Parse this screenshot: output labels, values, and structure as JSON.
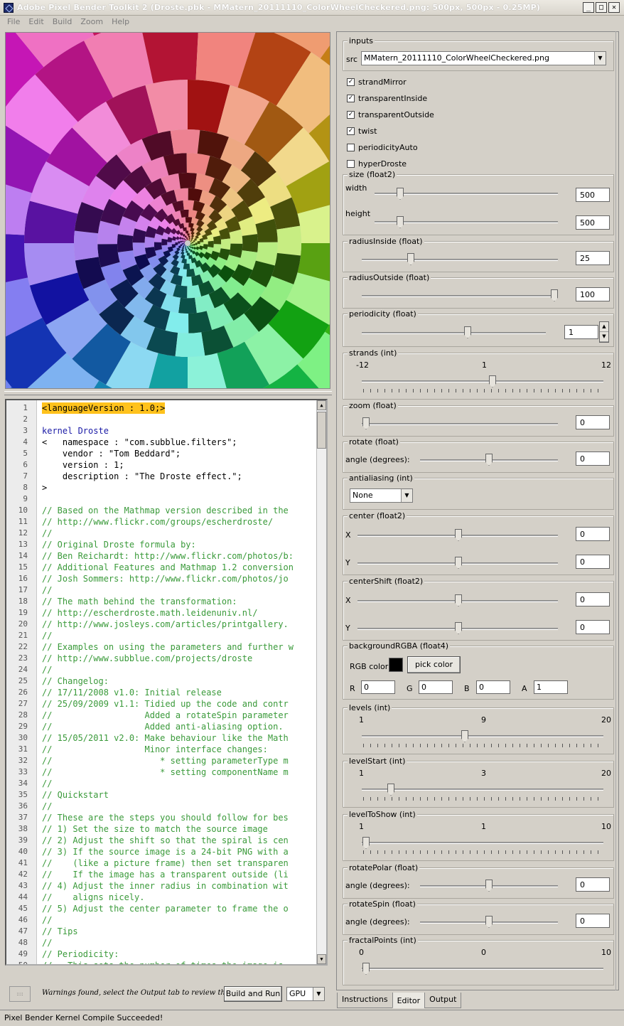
{
  "window": {
    "title": "Adobe Pixel Bender Toolkit 2 (Droste.pbk - MMatern_20111110_ColorWheelCheckered.png: 500px, 500px - 0.25MP)",
    "min": "_",
    "max": "□",
    "close": "✕"
  },
  "menu": [
    "File",
    "Edit",
    "Build",
    "Zoom",
    "Help"
  ],
  "code_lines": [
    {
      "n": "1",
      "t": "<languageVersion : 1.0;>",
      "c": "hl"
    },
    {
      "n": "2",
      "t": "",
      "c": ""
    },
    {
      "n": "3",
      "t": "kernel Droste",
      "c": "kw"
    },
    {
      "n": "4",
      "t": "<   namespace : \"com.subblue.filters\";",
      "c": ""
    },
    {
      "n": "5",
      "t": "    vendor : \"Tom Beddard\";",
      "c": ""
    },
    {
      "n": "6",
      "t": "    version : 1;",
      "c": ""
    },
    {
      "n": "7",
      "t": "    description : \"The Droste effect.\";",
      "c": ""
    },
    {
      "n": "8",
      "t": ">",
      "c": ""
    },
    {
      "n": "9",
      "t": "",
      "c": ""
    },
    {
      "n": "10",
      "t": "// Based on the Mathmap version described in the",
      "c": "comment"
    },
    {
      "n": "11",
      "t": "// http://www.flickr.com/groups/escherdroste/",
      "c": "comment"
    },
    {
      "n": "12",
      "t": "//",
      "c": "comment"
    },
    {
      "n": "13",
      "t": "// Original Droste formula by:",
      "c": "comment"
    },
    {
      "n": "14",
      "t": "// Ben Reichardt: http://www.flickr.com/photos/b:",
      "c": "comment"
    },
    {
      "n": "15",
      "t": "// Additional Features and Mathmap 1.2 conversion",
      "c": "comment"
    },
    {
      "n": "16",
      "t": "// Josh Sommers: http://www.flickr.com/photos/jo",
      "c": "comment"
    },
    {
      "n": "17",
      "t": "//",
      "c": "comment"
    },
    {
      "n": "18",
      "t": "// The math behind the transformation:",
      "c": "comment"
    },
    {
      "n": "19",
      "t": "// http://escherdroste.math.leidenuniv.nl/",
      "c": "comment"
    },
    {
      "n": "20",
      "t": "// http://www.josleys.com/articles/printgallery.",
      "c": "comment"
    },
    {
      "n": "21",
      "t": "//",
      "c": "comment"
    },
    {
      "n": "22",
      "t": "// Examples on using the parameters and further w",
      "c": "comment"
    },
    {
      "n": "23",
      "t": "// http://www.subblue.com/projects/droste",
      "c": "comment"
    },
    {
      "n": "24",
      "t": "//",
      "c": "comment"
    },
    {
      "n": "25",
      "t": "// Changelog:",
      "c": "comment"
    },
    {
      "n": "26",
      "t": "// 17/11/2008 v1.0: Initial release",
      "c": "comment"
    },
    {
      "n": "27",
      "t": "// 25/09/2009 v1.1: Tidied up the code and contr",
      "c": "comment"
    },
    {
      "n": "28",
      "t": "//                  Added a rotateSpin parameter",
      "c": "comment"
    },
    {
      "n": "29",
      "t": "//                  Added anti-aliasing option.",
      "c": "comment"
    },
    {
      "n": "30",
      "t": "// 15/05/2011 v2.0: Make behaviour like the Math",
      "c": "comment"
    },
    {
      "n": "31",
      "t": "//                  Minor interface changes:",
      "c": "comment"
    },
    {
      "n": "32",
      "t": "//                     * setting parameterType m",
      "c": "comment"
    },
    {
      "n": "33",
      "t": "//                     * setting componentName m",
      "c": "comment"
    },
    {
      "n": "34",
      "t": "//",
      "c": "comment"
    },
    {
      "n": "35",
      "t": "// Quickstart",
      "c": "comment"
    },
    {
      "n": "36",
      "t": "//",
      "c": "comment"
    },
    {
      "n": "37",
      "t": "// These are the steps you should follow for bes",
      "c": "comment"
    },
    {
      "n": "38",
      "t": "// 1) Set the size to match the source image",
      "c": "comment"
    },
    {
      "n": "39",
      "t": "// 2) Adjust the shift so that the spiral is cen",
      "c": "comment"
    },
    {
      "n": "40",
      "t": "// 3) If the source image is a 24-bit PNG with a",
      "c": "comment"
    },
    {
      "n": "41",
      "t": "//    (like a picture frame) then set transparen",
      "c": "comment"
    },
    {
      "n": "42",
      "t": "//    If the image has a transparent outside (li",
      "c": "comment"
    },
    {
      "n": "43",
      "t": "// 4) Adjust the inner radius in combination wit",
      "c": "comment"
    },
    {
      "n": "44",
      "t": "//    aligns nicely.",
      "c": "comment"
    },
    {
      "n": "45",
      "t": "// 5) Adjust the center parameter to frame the o",
      "c": "comment"
    },
    {
      "n": "46",
      "t": "//",
      "c": "comment"
    },
    {
      "n": "47",
      "t": "// Tips",
      "c": "comment"
    },
    {
      "n": "48",
      "t": "//",
      "c": "comment"
    },
    {
      "n": "49",
      "t": "// Periodicity:",
      "c": "comment"
    },
    {
      "n": "50",
      "t": "//   This sets the number of times the image is",
      "c": "comment"
    }
  ],
  "bottom": {
    "grip": "::::",
    "warning": "Warnings found, select the Output tab to review them.",
    "build_button": "Build and Run",
    "device": "GPU"
  },
  "status": "Pixel Bender Kernel Compile Succeeded!",
  "params": {
    "inputs": {
      "label": "inputs",
      "src_label": "src",
      "src_value": "MMatern_20111110_ColorWheelCheckered.png"
    },
    "checkboxes": [
      {
        "label": "strandMirror",
        "checked": true
      },
      {
        "label": "transparentInside",
        "checked": true
      },
      {
        "label": "transparentOutside",
        "checked": true
      },
      {
        "label": "twist",
        "checked": true
      },
      {
        "label": "periodicityAuto",
        "checked": false
      },
      {
        "label": "hyperDroste",
        "checked": false
      }
    ],
    "size": {
      "label": "size (float2)",
      "width_label": "width",
      "width": "500",
      "height_label": "height",
      "height": "500"
    },
    "radiusInside": {
      "label": "radiusInside (float)",
      "value": "25"
    },
    "radiusOutside": {
      "label": "radiusOutside (float)",
      "value": "100"
    },
    "periodicity": {
      "label": "periodicity (float)",
      "value": "1"
    },
    "strands": {
      "label": "strands (int)",
      "min": "-12",
      "cur": "1",
      "max": "12"
    },
    "zoom": {
      "label": "zoom (float)",
      "value": "0"
    },
    "rotate": {
      "label": "rotate (float)",
      "angle_label": "angle (degrees):",
      "value": "0"
    },
    "antialiasing": {
      "label": "antialiasing (int)",
      "value": "None"
    },
    "center": {
      "label": "center (float2)",
      "x_label": "X",
      "x": "0",
      "y_label": "Y",
      "y": "0"
    },
    "centerShift": {
      "label": "centerShift (float2)",
      "x_label": "X",
      "x": "0",
      "y_label": "Y",
      "y": "0"
    },
    "backgroundRGBA": {
      "label": "backgroundRGBA (float4)",
      "rgb_label": "RGB color:",
      "pick": "pick color",
      "swatch": "#000000",
      "r_label": "R",
      "r": "0",
      "g_label": "G",
      "g": "0",
      "b_label": "B",
      "b": "0",
      "a_label": "A",
      "a": "1"
    },
    "levels": {
      "label": "levels (int)",
      "min": "1",
      "cur": "9",
      "max": "20"
    },
    "levelStart": {
      "label": "levelStart (int)",
      "min": "1",
      "cur": "3",
      "max": "20"
    },
    "levelToShow": {
      "label": "levelToShow (int)",
      "min": "1",
      "cur": "1",
      "max": "10"
    },
    "rotatePolar": {
      "label": "rotatePolar (float)",
      "angle_label": "angle (degrees):",
      "value": "0"
    },
    "rotateSpin": {
      "label": "rotateSpin (float)",
      "angle_label": "angle (degrees):",
      "value": "0"
    },
    "fractalPoints": {
      "label": "fractalPoints (int)",
      "min": "0",
      "cur": "0",
      "max": "10"
    }
  },
  "tabs": [
    "Instructions",
    "Editor",
    "Output"
  ],
  "active_tab": "Editor"
}
